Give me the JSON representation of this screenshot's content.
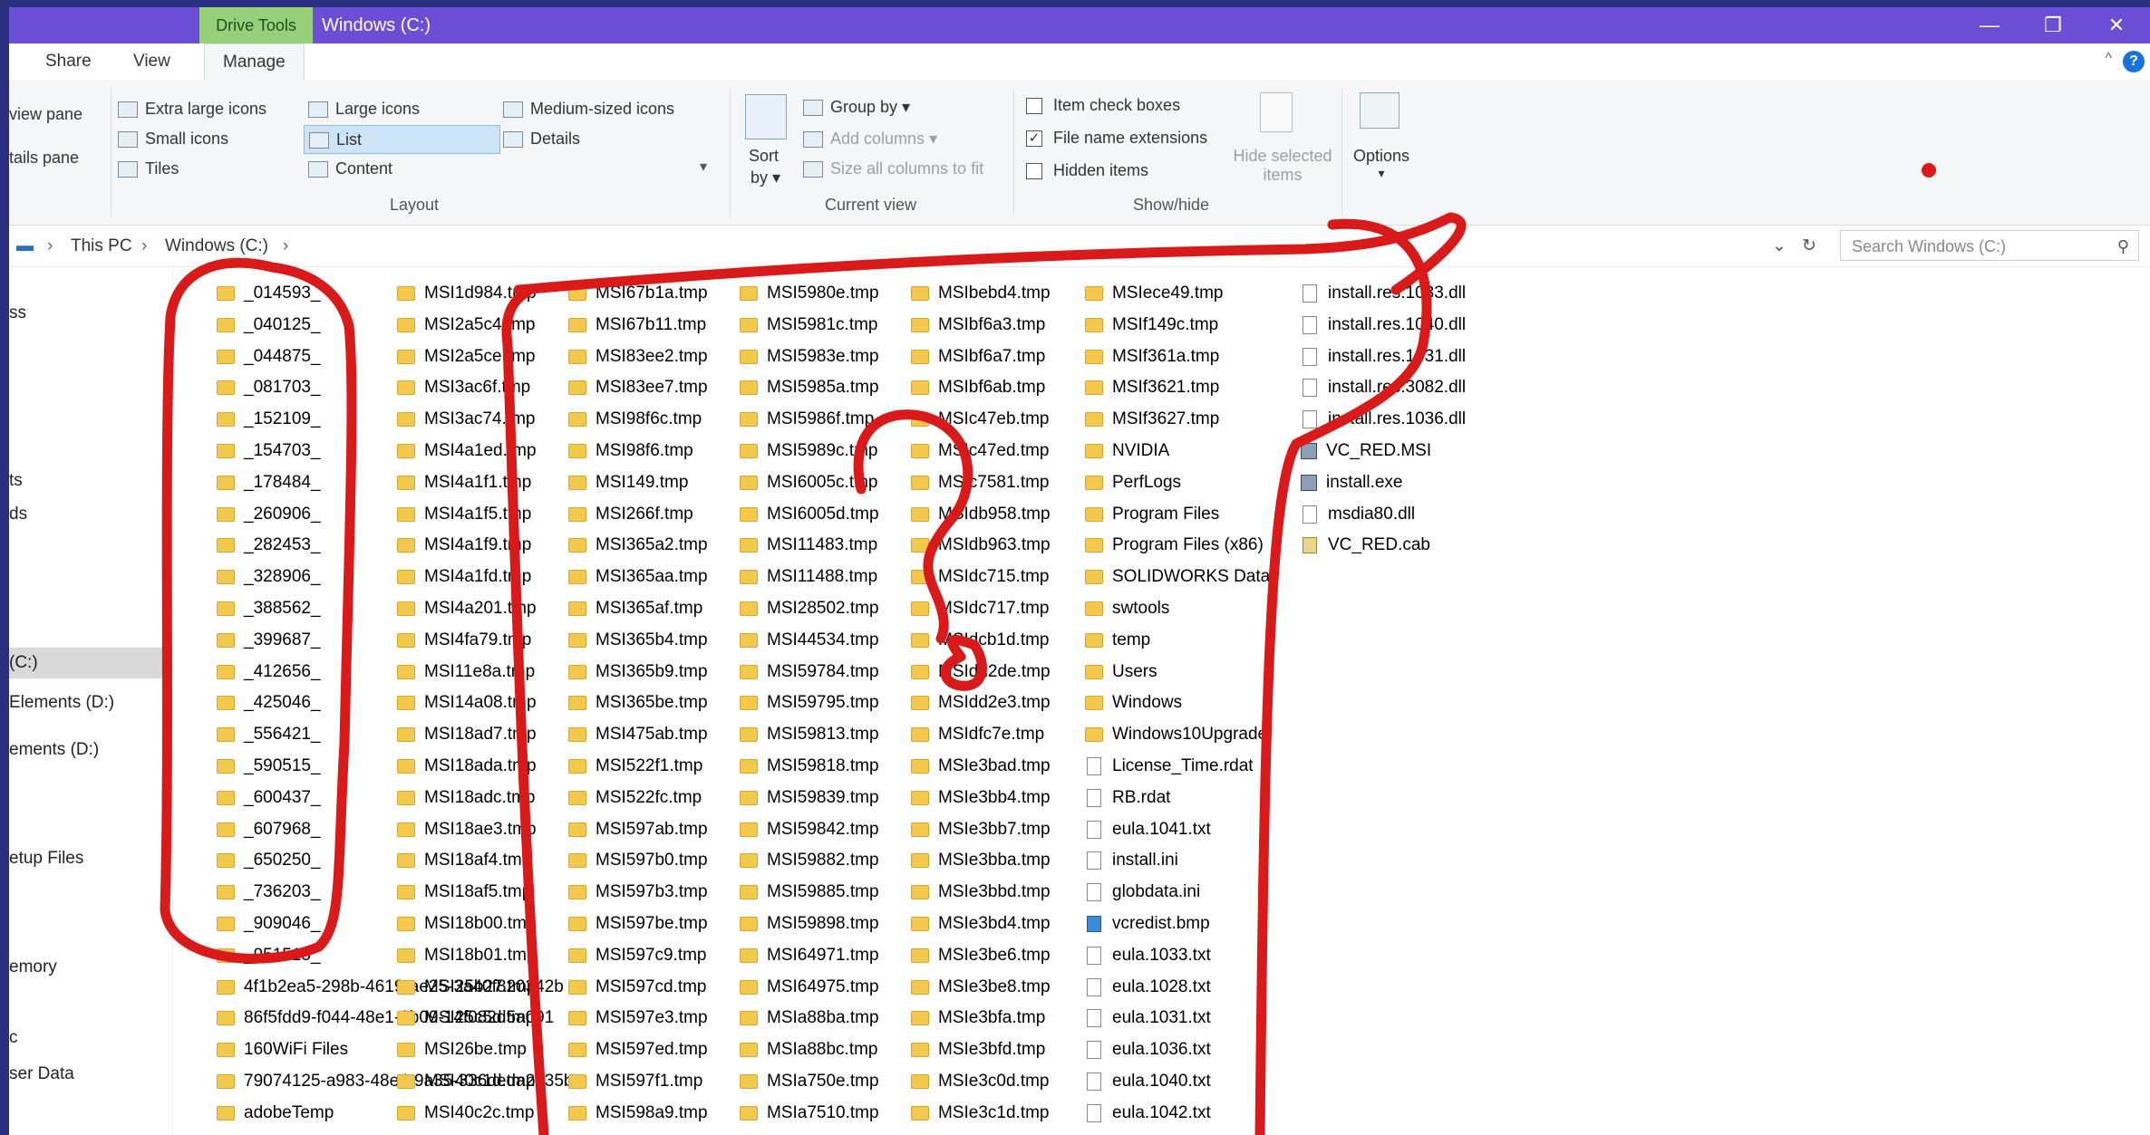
{
  "window": {
    "tool_tab": "Drive Tools",
    "title": "Windows (C:)",
    "minimize_glyph": "—",
    "restore_glyph": "❐",
    "close_glyph": "✕"
  },
  "tabs": {
    "share": "Share",
    "view": "View",
    "manage": "Manage",
    "help": "?",
    "collapse": "^"
  },
  "ribbon": {
    "panes": {
      "preview": "view pane",
      "details": "tails pane"
    },
    "layout": {
      "extra_large": "Extra large icons",
      "large": "Large icons",
      "medium": "Medium-sized icons",
      "small": "Small icons",
      "list": "List",
      "details": "Details",
      "tiles": "Tiles",
      "content": "Content",
      "label": "Layout"
    },
    "current_view": {
      "sort": "Sort",
      "by": "by",
      "group_by": "Group by",
      "add_columns": "Add columns",
      "size_columns": "Size all columns to fit",
      "label": "Current view"
    },
    "show_hide": {
      "item_check_boxes": "Item check boxes",
      "item_check_boxes_checked": false,
      "file_name_extensions": "File name extensions",
      "file_name_extensions_checked": true,
      "hidden_items": "Hidden items",
      "hidden_items_checked": false,
      "hide_selected": "Hide selected",
      "items": "items",
      "label": "Show/hide"
    },
    "options": "Options"
  },
  "address": {
    "this_pc": "This PC",
    "drive": "Windows (C:)",
    "search_placeholder": "Search Windows (C:)"
  },
  "nav": [
    {
      "label": "ss",
      "y": 0
    },
    {
      "label": "ts",
      "y": 0
    },
    {
      "label": "ds",
      "y": 0
    },
    {
      "label": "(C:)",
      "y": 0,
      "selected": true
    },
    {
      "label": "Elements (D:)",
      "y": 0
    },
    {
      "label": "ements (D:)",
      "y": 0
    },
    {
      "label": "etup Files",
      "y": 0
    },
    {
      "label": "emory",
      "y": 0
    },
    {
      "label": "c",
      "y": 0
    },
    {
      "label": "ser Data",
      "y": 0
    }
  ],
  "columns": [
    {
      "items": [
        {
          "name": "_014593_",
          "type": "folder"
        },
        {
          "name": "_040125_",
          "type": "folder"
        },
        {
          "name": "_044875_",
          "type": "folder"
        },
        {
          "name": "_081703_",
          "type": "folder"
        },
        {
          "name": "_152109_",
          "type": "folder"
        },
        {
          "name": "_154703_",
          "type": "folder"
        },
        {
          "name": "_178484_",
          "type": "folder"
        },
        {
          "name": "_260906_",
          "type": "folder"
        },
        {
          "name": "_282453_",
          "type": "folder"
        },
        {
          "name": "_328906_",
          "type": "folder"
        },
        {
          "name": "_388562_",
          "type": "folder"
        },
        {
          "name": "_399687_",
          "type": "folder"
        },
        {
          "name": "_412656_",
          "type": "folder"
        },
        {
          "name": "_425046_",
          "type": "folder"
        },
        {
          "name": "_556421_",
          "type": "folder"
        },
        {
          "name": "_590515_",
          "type": "folder"
        },
        {
          "name": "_600437_",
          "type": "folder"
        },
        {
          "name": "_607968_",
          "type": "folder"
        },
        {
          "name": "_650250_",
          "type": "folder"
        },
        {
          "name": "_736203_",
          "type": "folder"
        },
        {
          "name": "_909046_",
          "type": "folder"
        },
        {
          "name": "_951515_",
          "type": "folder"
        },
        {
          "name": "4f1b2ea5-298b-4619-ae25-3a40f820342b",
          "type": "folder"
        },
        {
          "name": "86f5fdd9-f044-48e1-9b09-14f082d5a091",
          "type": "folder"
        },
        {
          "name": "160WiFi Files",
          "type": "folder"
        },
        {
          "name": "79074125-a983-48e4-9a35-336deda2d35b",
          "type": "folder"
        },
        {
          "name": "adobeTemp",
          "type": "folder"
        }
      ]
    },
    {
      "items": [
        {
          "name": "MSI1d984.tmp",
          "type": "folder"
        },
        {
          "name": "MSI2a5c4.tmp",
          "type": "folder"
        },
        {
          "name": "MSI2a5ce.tmp",
          "type": "folder"
        },
        {
          "name": "MSI3ac6f.tmp",
          "type": "folder"
        },
        {
          "name": "MSI3ac74.tmp",
          "type": "folder"
        },
        {
          "name": "MSI4a1ed.tmp",
          "type": "folder"
        },
        {
          "name": "MSI4a1f1.tmp",
          "type": "folder"
        },
        {
          "name": "MSI4a1f5.tmp",
          "type": "folder"
        },
        {
          "name": "MSI4a1f9.tmp",
          "type": "folder"
        },
        {
          "name": "MSI4a1fd.tmp",
          "type": "folder"
        },
        {
          "name": "MSI4a201.tmp",
          "type": "folder"
        },
        {
          "name": "MSI4fa79.tmp",
          "type": "folder"
        },
        {
          "name": "MSI11e8a.tmp",
          "type": "folder"
        },
        {
          "name": "MSI14a08.tmp",
          "type": "folder"
        },
        {
          "name": "MSI18ad7.tmp",
          "type": "folder"
        },
        {
          "name": "MSI18ada.tmp",
          "type": "folder"
        },
        {
          "name": "MSI18adc.tmp",
          "type": "folder"
        },
        {
          "name": "MSI18ae3.tmp",
          "type": "folder"
        },
        {
          "name": "MSI18af4.tmp",
          "type": "folder"
        },
        {
          "name": "MSI18af5.tmp",
          "type": "folder"
        },
        {
          "name": "MSI18b00.tmp",
          "type": "folder"
        },
        {
          "name": "MSI18b01.tmp",
          "type": "folder"
        },
        {
          "name": "MSI25b27.tmp",
          "type": "folder"
        },
        {
          "name": "MSI25c5d.tmp",
          "type": "folder"
        },
        {
          "name": "MSI26be.tmp",
          "type": "folder"
        },
        {
          "name": "MSI40c1d.tmp",
          "type": "folder"
        },
        {
          "name": "MSI40c2c.tmp",
          "type": "folder"
        }
      ]
    },
    {
      "items": [
        {
          "name": "MSI67b1a.tmp",
          "type": "folder"
        },
        {
          "name": "MSI67b11.tmp",
          "type": "folder"
        },
        {
          "name": "MSI83ee2.tmp",
          "type": "folder"
        },
        {
          "name": "MSI83ee7.tmp",
          "type": "folder"
        },
        {
          "name": "MSI98f6c.tmp",
          "type": "folder"
        },
        {
          "name": "MSI98f6.tmp",
          "type": "folder"
        },
        {
          "name": "MSI149.tmp",
          "type": "folder"
        },
        {
          "name": "MSI266f.tmp",
          "type": "folder"
        },
        {
          "name": "MSI365a2.tmp",
          "type": "folder"
        },
        {
          "name": "MSI365aa.tmp",
          "type": "folder"
        },
        {
          "name": "MSI365af.tmp",
          "type": "folder"
        },
        {
          "name": "MSI365b4.tmp",
          "type": "folder"
        },
        {
          "name": "MSI365b9.tmp",
          "type": "folder"
        },
        {
          "name": "MSI365be.tmp",
          "type": "folder"
        },
        {
          "name": "MSI475ab.tmp",
          "type": "folder"
        },
        {
          "name": "MSI522f1.tmp",
          "type": "folder"
        },
        {
          "name": "MSI522fc.tmp",
          "type": "folder"
        },
        {
          "name": "MSI597ab.tmp",
          "type": "folder"
        },
        {
          "name": "MSI597b0.tmp",
          "type": "folder"
        },
        {
          "name": "MSI597b3.tmp",
          "type": "folder"
        },
        {
          "name": "MSI597be.tmp",
          "type": "folder"
        },
        {
          "name": "MSI597c9.tmp",
          "type": "folder"
        },
        {
          "name": "MSI597cd.tmp",
          "type": "folder"
        },
        {
          "name": "MSI597e3.tmp",
          "type": "folder"
        },
        {
          "name": "MSI597ed.tmp",
          "type": "folder"
        },
        {
          "name": "MSI597f1.tmp",
          "type": "folder"
        },
        {
          "name": "MSI598a9.tmp",
          "type": "folder"
        }
      ]
    },
    {
      "items": [
        {
          "name": "MSI5980e.tmp",
          "type": "folder"
        },
        {
          "name": "MSI5981c.tmp",
          "type": "folder"
        },
        {
          "name": "MSI5983e.tmp",
          "type": "folder"
        },
        {
          "name": "MSI5985a.tmp",
          "type": "folder"
        },
        {
          "name": "MSI5986f.tmp",
          "type": "folder"
        },
        {
          "name": "MSI5989c.tmp",
          "type": "folder"
        },
        {
          "name": "MSI6005c.tmp",
          "type": "folder"
        },
        {
          "name": "MSI6005d.tmp",
          "type": "folder"
        },
        {
          "name": "MSI11483.tmp",
          "type": "folder"
        },
        {
          "name": "MSI11488.tmp",
          "type": "folder"
        },
        {
          "name": "MSI28502.tmp",
          "type": "folder"
        },
        {
          "name": "MSI44534.tmp",
          "type": "folder"
        },
        {
          "name": "MSI59784.tmp",
          "type": "folder"
        },
        {
          "name": "MSI59795.tmp",
          "type": "folder"
        },
        {
          "name": "MSI59813.tmp",
          "type": "folder"
        },
        {
          "name": "MSI59818.tmp",
          "type": "folder"
        },
        {
          "name": "MSI59839.tmp",
          "type": "folder"
        },
        {
          "name": "MSI59842.tmp",
          "type": "folder"
        },
        {
          "name": "MSI59882.tmp",
          "type": "folder"
        },
        {
          "name": "MSI59885.tmp",
          "type": "folder"
        },
        {
          "name": "MSI59898.tmp",
          "type": "folder"
        },
        {
          "name": "MSI64971.tmp",
          "type": "folder"
        },
        {
          "name": "MSI64975.tmp",
          "type": "folder"
        },
        {
          "name": "MSIa88ba.tmp",
          "type": "folder"
        },
        {
          "name": "MSIa88bc.tmp",
          "type": "folder"
        },
        {
          "name": "MSIa750e.tmp",
          "type": "folder"
        },
        {
          "name": "MSIa7510.tmp",
          "type": "folder"
        }
      ]
    },
    {
      "items": [
        {
          "name": "MSIbebd4.tmp",
          "type": "folder"
        },
        {
          "name": "MSIbf6a3.tmp",
          "type": "folder"
        },
        {
          "name": "MSIbf6a7.tmp",
          "type": "folder"
        },
        {
          "name": "MSIbf6ab.tmp",
          "type": "folder"
        },
        {
          "name": "MSIc47eb.tmp",
          "type": "folder"
        },
        {
          "name": "MSIc47ed.tmp",
          "type": "folder"
        },
        {
          "name": "MSIc7581.tmp",
          "type": "folder"
        },
        {
          "name": "MSIdb958.tmp",
          "type": "folder"
        },
        {
          "name": "MSIdb963.tmp",
          "type": "folder"
        },
        {
          "name": "MSIdc715.tmp",
          "type": "folder"
        },
        {
          "name": "MSIdc717.tmp",
          "type": "folder"
        },
        {
          "name": "MSIdcb1d.tmp",
          "type": "folder"
        },
        {
          "name": "MSIdd2de.tmp",
          "type": "folder"
        },
        {
          "name": "MSIdd2e3.tmp",
          "type": "folder"
        },
        {
          "name": "MSIdfc7e.tmp",
          "type": "folder"
        },
        {
          "name": "MSIe3bad.tmp",
          "type": "folder"
        },
        {
          "name": "MSIe3bb4.tmp",
          "type": "folder"
        },
        {
          "name": "MSIe3bb7.tmp",
          "type": "folder"
        },
        {
          "name": "MSIe3bba.tmp",
          "type": "folder"
        },
        {
          "name": "MSIe3bbd.tmp",
          "type": "folder"
        },
        {
          "name": "MSIe3bd4.tmp",
          "type": "folder"
        },
        {
          "name": "MSIe3be6.tmp",
          "type": "folder"
        },
        {
          "name": "MSIe3be8.tmp",
          "type": "folder"
        },
        {
          "name": "MSIe3bfa.tmp",
          "type": "folder"
        },
        {
          "name": "MSIe3bfd.tmp",
          "type": "folder"
        },
        {
          "name": "MSIe3c0d.tmp",
          "type": "folder"
        },
        {
          "name": "MSIe3c1d.tmp",
          "type": "folder"
        }
      ]
    },
    {
      "items": [
        {
          "name": "MSIece49.tmp",
          "type": "folder"
        },
        {
          "name": "MSIf149c.tmp",
          "type": "folder"
        },
        {
          "name": "MSIf361a.tmp",
          "type": "folder"
        },
        {
          "name": "MSIf3621.tmp",
          "type": "folder"
        },
        {
          "name": "MSIf3627.tmp",
          "type": "folder"
        },
        {
          "name": "NVIDIA",
          "type": "folder"
        },
        {
          "name": "PerfLogs",
          "type": "folder"
        },
        {
          "name": "Program Files",
          "type": "folder"
        },
        {
          "name": "Program Files (x86)",
          "type": "folder"
        },
        {
          "name": "SOLIDWORKS Data",
          "type": "folder"
        },
        {
          "name": "swtools",
          "type": "folder"
        },
        {
          "name": "temp",
          "type": "folder"
        },
        {
          "name": "Users",
          "type": "folder"
        },
        {
          "name": "Windows",
          "type": "folder"
        },
        {
          "name": "Windows10Upgrade",
          "type": "folder"
        },
        {
          "name": "License_Time.rdat",
          "type": "file"
        },
        {
          "name": "RB.rdat",
          "type": "file"
        },
        {
          "name": "eula.1041.txt",
          "type": "file"
        },
        {
          "name": "install.ini",
          "type": "file"
        },
        {
          "name": "globdata.ini",
          "type": "file"
        },
        {
          "name": "vcredist.bmp",
          "type": "img"
        },
        {
          "name": "eula.1033.txt",
          "type": "file"
        },
        {
          "name": "eula.1028.txt",
          "type": "file"
        },
        {
          "name": "eula.1031.txt",
          "type": "file"
        },
        {
          "name": "eula.1036.txt",
          "type": "file"
        },
        {
          "name": "eula.1040.txt",
          "type": "file"
        },
        {
          "name": "eula.1042.txt",
          "type": "file"
        }
      ]
    },
    {
      "items": [
        {
          "name": "install.res.1033.dll",
          "type": "file"
        },
        {
          "name": "install.res.1040.dll",
          "type": "file"
        },
        {
          "name": "install.res.1031.dll",
          "type": "file"
        },
        {
          "name": "install.res.3082.dll",
          "type": "file"
        },
        {
          "name": "install.res.1036.dll",
          "type": "file"
        },
        {
          "name": "VC_RED.MSI",
          "type": "exe"
        },
        {
          "name": "install.exe",
          "type": "exe"
        },
        {
          "name": "msdia80.dll",
          "type": "file"
        },
        {
          "name": "VC_RED.cab",
          "type": "cab"
        }
      ]
    }
  ],
  "colors": {
    "annotation": "#d91a1a",
    "titlebar": "#6a4fd6",
    "drive_tools": "#97cf7a"
  }
}
